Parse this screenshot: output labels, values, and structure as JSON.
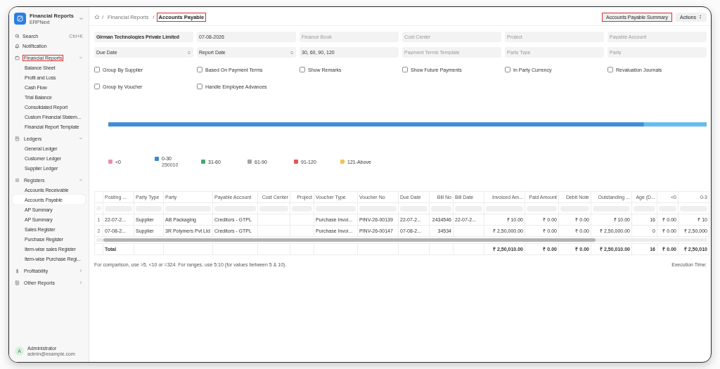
{
  "sidebar": {
    "app_title": "Financial Reports",
    "app_subtitle": "ERPNext",
    "search": {
      "label": "Search",
      "shortcut": "Ctrl+K"
    },
    "notification": "Notification",
    "groups": [
      {
        "label": "Financial Reports",
        "expanded": true,
        "highlighted": true,
        "children": [
          {
            "label": "Balance Sheet",
            "selected": false
          },
          {
            "label": "Profit and Loss",
            "selected": false
          },
          {
            "label": "Cash Flow",
            "selected": false
          },
          {
            "label": "Trial Balance",
            "selected": false
          },
          {
            "label": "Consolidated Report",
            "selected": false
          },
          {
            "label": "Custom Financial Statem...",
            "selected": false
          },
          {
            "label": "Financial Report Template",
            "selected": false
          }
        ]
      },
      {
        "label": "Ledgers",
        "expanded": true,
        "highlighted": false,
        "children": [
          {
            "label": "General Ledger",
            "selected": false
          },
          {
            "label": "Customer Ledger",
            "selected": false
          },
          {
            "label": "Supplier Ledger",
            "selected": false
          }
        ]
      },
      {
        "label": "Registers",
        "expanded": true,
        "highlighted": false,
        "children": [
          {
            "label": "Accounts Receivable",
            "selected": false
          },
          {
            "label": "Accounts Payable",
            "selected": true
          },
          {
            "label": "AP Summary",
            "selected": false
          },
          {
            "label": "AP Summary",
            "selected": false
          },
          {
            "label": "Sales Register",
            "selected": false
          },
          {
            "label": "Purchase Register",
            "selected": false
          },
          {
            "label": "Item-wise sales Register",
            "selected": false
          },
          {
            "label": "Item-wise Purchase Regi...",
            "selected": false
          }
        ]
      },
      {
        "label": "Profitability",
        "expanded": false,
        "highlighted": false
      },
      {
        "label": "Other Reports",
        "expanded": false,
        "highlighted": false
      }
    ],
    "user": {
      "avatar": "A",
      "name": "Administrator",
      "email": "admin@example.com"
    }
  },
  "breadcrumb": {
    "separator": "/",
    "items": [
      {
        "label": "Financial Reports",
        "current": false,
        "highlighted": false
      },
      {
        "label": "Accounts Payable",
        "current": true,
        "highlighted": true
      }
    ]
  },
  "header_buttons": [
    {
      "label": "Accounts Payable Summary",
      "kind": "plain",
      "highlighted": true
    },
    {
      "label": "Actions",
      "kind": "menu",
      "highlighted": false
    }
  ],
  "filters": [
    {
      "kind": "link",
      "value": "Girman Technologies Private Limited"
    },
    {
      "kind": "input",
      "value": "07-08-2026"
    },
    {
      "kind": "input",
      "placeholder": "Finance Book"
    },
    {
      "kind": "input",
      "placeholder": "Cost Center"
    },
    {
      "kind": "input",
      "placeholder": "Project"
    },
    {
      "kind": "input",
      "placeholder": "Payable Account"
    },
    {
      "kind": "select",
      "value": "Due Date"
    },
    {
      "kind": "select",
      "value": "Report Date"
    },
    {
      "kind": "input",
      "value": "30, 60, 90, 120"
    },
    {
      "kind": "input",
      "placeholder": "Payment Terms Template"
    },
    {
      "kind": "input",
      "placeholder": "Party Type"
    },
    {
      "kind": "input",
      "placeholder": "Party"
    }
  ],
  "checkboxes": [
    {
      "label": "Group By Supplier",
      "checked": false
    },
    {
      "label": "Based On Payment Terms",
      "checked": false
    },
    {
      "label": "Show Remarks",
      "checked": false
    },
    {
      "label": "Show Future Payments",
      "checked": false
    },
    {
      "label": "In Party Currency",
      "checked": false
    },
    {
      "label": "Revaluation Journals",
      "checked": false
    },
    {
      "label": "Group by Voucher",
      "checked": false
    },
    {
      "label": "Handle Employee Advances",
      "checked": false
    }
  ],
  "aging_chart": {
    "legend": [
      {
        "label": "<0",
        "color": "#e68fb1"
      },
      {
        "label": "0-30",
        "color": "#3b87cf",
        "value": "250010"
      },
      {
        "label": "31-60",
        "color": "#48a870"
      },
      {
        "label": "61-90",
        "color": "#a0a6ab"
      },
      {
        "label": "91-120",
        "color": "#e0585b"
      },
      {
        "label": "121-Above",
        "color": "#f0c45a"
      }
    ]
  },
  "table": {
    "columns": [
      "Posting ...",
      "Party Type",
      "Party",
      "Payable Account",
      "Cost Center",
      "Project",
      "Voucher Type",
      "Voucher No",
      "Due Date",
      "Bill No",
      "Bill Date",
      "Invoiced Am...",
      "Paid Amount",
      "Debit Note",
      "Outstanding ...",
      "Age (D...",
      "<0",
      "0-3"
    ],
    "rows": [
      {
        "index": "1",
        "posting_date": "22-07-2...",
        "party_type": "Supplier",
        "party": "AB Packaging",
        "payable_account": "Creditors - GTPL",
        "voucher_type": "Purchase Invoi...",
        "voucher_no": "PINV-26-00139",
        "due_date": "22-07-2...",
        "bill_no": "2434546",
        "bill_date": "22-07-2...",
        "invoiced_amount": "₹ 10.00",
        "paid_amount": "₹ 0.00",
        "debit_note": "₹ 0.00",
        "outstanding_amount": "₹ 10.00",
        "age": "16",
        "range_below_0": "₹ 0.00",
        "range_0_30": "₹ 10"
      },
      {
        "index": "2",
        "posting_date": "07-08-2...",
        "party_type": "Supplier",
        "party": "3R Polymers Pvt Ltd",
        "payable_account": "Creditors - GTPL",
        "voucher_type": "Purchase Invoi...",
        "voucher_no": "PINV-26-00147",
        "due_date": "07-08-2...",
        "bill_no": "34534",
        "invoiced_amount": "₹ 2,50,000.00",
        "paid_amount": "₹ 0.00",
        "debit_note": "₹ 0.00",
        "outstanding_amount": "₹ 2,50,000.00",
        "age": "0",
        "range_below_0": "₹ 0.00",
        "range_0_30": "₹ 2,50,000"
      }
    ],
    "total": {
      "label": "Total",
      "invoiced_amount": "₹ 2,50,010.00",
      "paid_amount": "₹ 0.00",
      "debit_note": "₹ 0.00",
      "outstanding_amount": "₹ 2,50,010.00",
      "age": "16",
      "range_below_0": "₹ 0.00",
      "range_0_30": "₹ 2,50,010"
    }
  },
  "footer": {
    "note": "For comparison, use >5, <10 or =324. For ranges, use 5:10 (for values between 5 & 10).",
    "execution_time": "Execution Time:"
  }
}
